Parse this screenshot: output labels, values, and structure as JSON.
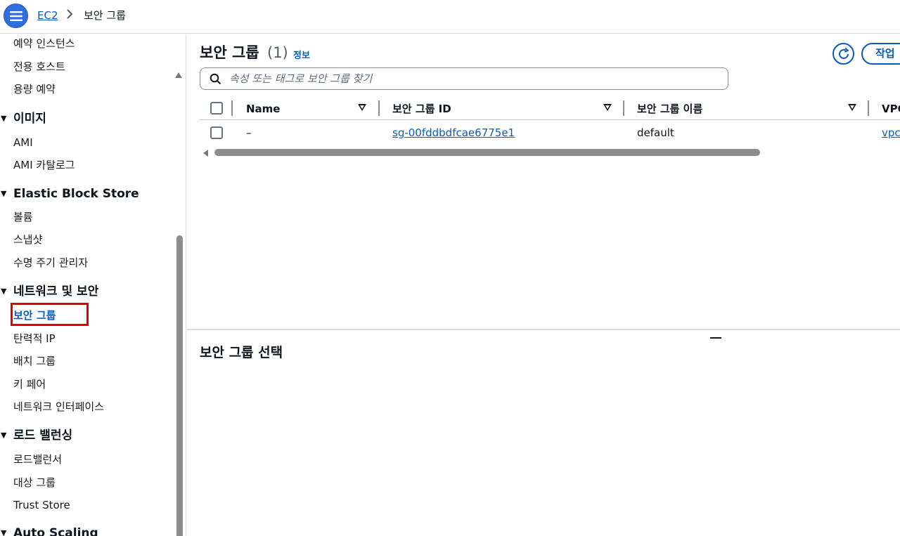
{
  "header": {
    "breadcrumb": {
      "root": "EC2",
      "current": "보안 그룹"
    },
    "menu_icon": "hamburger-menu-icon"
  },
  "sidebar": {
    "items": [
      {
        "label": "예약 인스턴스"
      },
      {
        "label": "전용 호스트"
      },
      {
        "label": "용량 예약"
      }
    ],
    "sections": [
      {
        "title": "이미지",
        "items": [
          "AMI",
          "AMI 카탈로그"
        ]
      },
      {
        "title": "Elastic Block Store",
        "items": [
          "볼륨",
          "스냅샷",
          "수명 주기 관리자"
        ]
      },
      {
        "title": "네트워크 및 보안",
        "items": [
          "보안 그룹",
          "탄력적 IP",
          "배치 그룹",
          "키 페어",
          "네트워크 인터페이스"
        ]
      },
      {
        "title": "로드 밸런싱",
        "items": [
          "로드밸런서",
          "대상 그룹",
          "Trust Store"
        ]
      },
      {
        "title": "Auto Scaling",
        "items": []
      }
    ],
    "active_item": "보안 그룹"
  },
  "main": {
    "title": "보안 그룹",
    "count": "(1)",
    "info_link": "정보",
    "action_button": "작업",
    "refresh_icon": "refresh-icon",
    "search": {
      "placeholder": "속성 또는 태그로 보안 그룹 찾기",
      "value": ""
    },
    "table": {
      "columns": [
        "Name",
        "보안 그룹 ID",
        "보안 그룹 이름",
        "VPC"
      ],
      "rows": [
        {
          "name": "–",
          "group_id": "sg-00fddbdfcae6775e1",
          "group_name": "default",
          "vpc": "vpc"
        }
      ]
    },
    "detail_title": "보안 그룹 선택"
  },
  "colors": {
    "accent": "#0b5cb8",
    "menu_button": "#2f6fe0",
    "highlight": "#e30000"
  }
}
